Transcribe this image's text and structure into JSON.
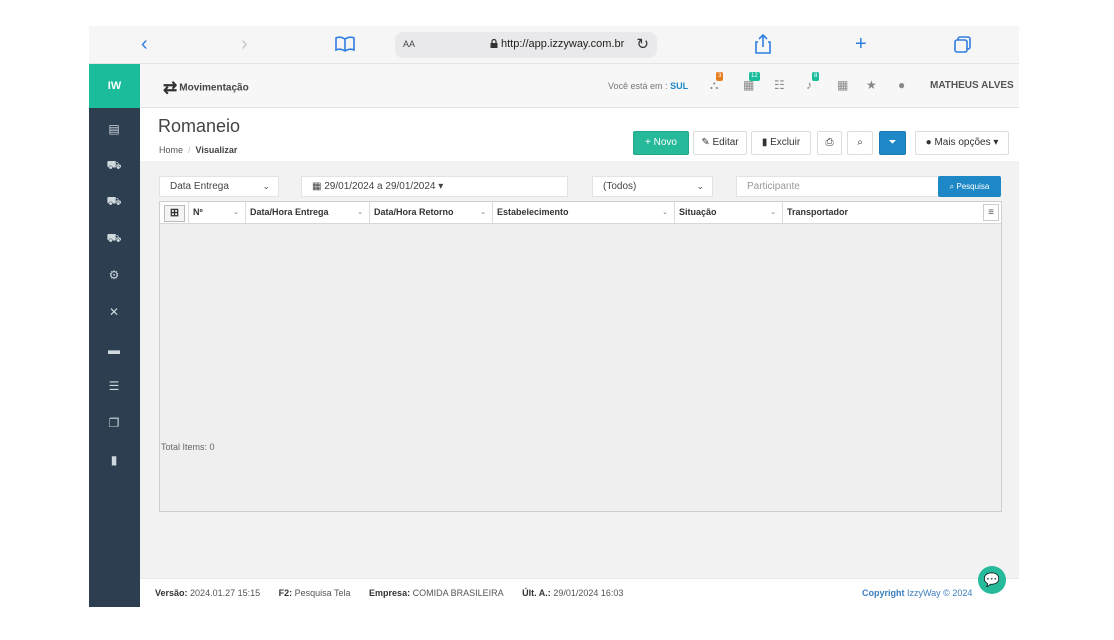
{
  "browser": {
    "back_icon": "‹",
    "forward_icon": "›",
    "reader_icon": "book-icon",
    "text_size": "AA",
    "url": "http://app.izzyway.com.br",
    "share_icon": "share-icon",
    "new_tab_icon": "+",
    "tabs_icon": "tabs-icon"
  },
  "sidebar": {
    "logo": "IW",
    "icons": [
      "chart-icon",
      "cart-icon",
      "cart-icon",
      "cart-icon",
      "cogs-icon",
      "tools-icon",
      "card-icon",
      "list-icon",
      "copy-icon",
      "file-icon"
    ]
  },
  "header": {
    "module_label": "Movimentação",
    "location_prefix": "Você está em :",
    "location_value": "SUL",
    "badges": [
      "3",
      "12",
      "",
      "8"
    ],
    "user_name": "MATHEUS ALVES"
  },
  "page": {
    "title": "Romaneio",
    "breadcrumb_home": "Home",
    "breadcrumb_current": "Visualizar"
  },
  "toolbar": {
    "novo": "+ Novo",
    "editar": "Editar",
    "excluir": "Excluir",
    "mais_opcoes": "Mais opções"
  },
  "filters": {
    "date_field": "Data Entrega",
    "date_range": "29/01/2024 a 29/01/2024",
    "status": "(Todos)",
    "participant_placeholder": "Participante",
    "search_button": "Pesquisa"
  },
  "grid": {
    "columns": [
      "Nº",
      "Data/Hora Entrega",
      "Data/Hora Retorno",
      "Estabelecimento",
      "Situação",
      "Transportador"
    ],
    "rows": [],
    "total_label": "Total Items: 0"
  },
  "footer": {
    "version_label": "Versão:",
    "version_value": "2024.01.27 15:15",
    "f2_label": "F2:",
    "f2_value": "Pesquisa Tela",
    "company_label": "Empresa:",
    "company_value": "COMIDA BRASILEIRA",
    "last_label": "ÚIt. A.:",
    "last_value": "29/01/2024 16:03",
    "copyright_label": "Copyright",
    "copyright_value": "IzzyWay © 2024"
  },
  "colors": {
    "sidebar": "#2c3e50",
    "accent_green": "#26b99a",
    "accent_blue": "#1e88c7"
  }
}
